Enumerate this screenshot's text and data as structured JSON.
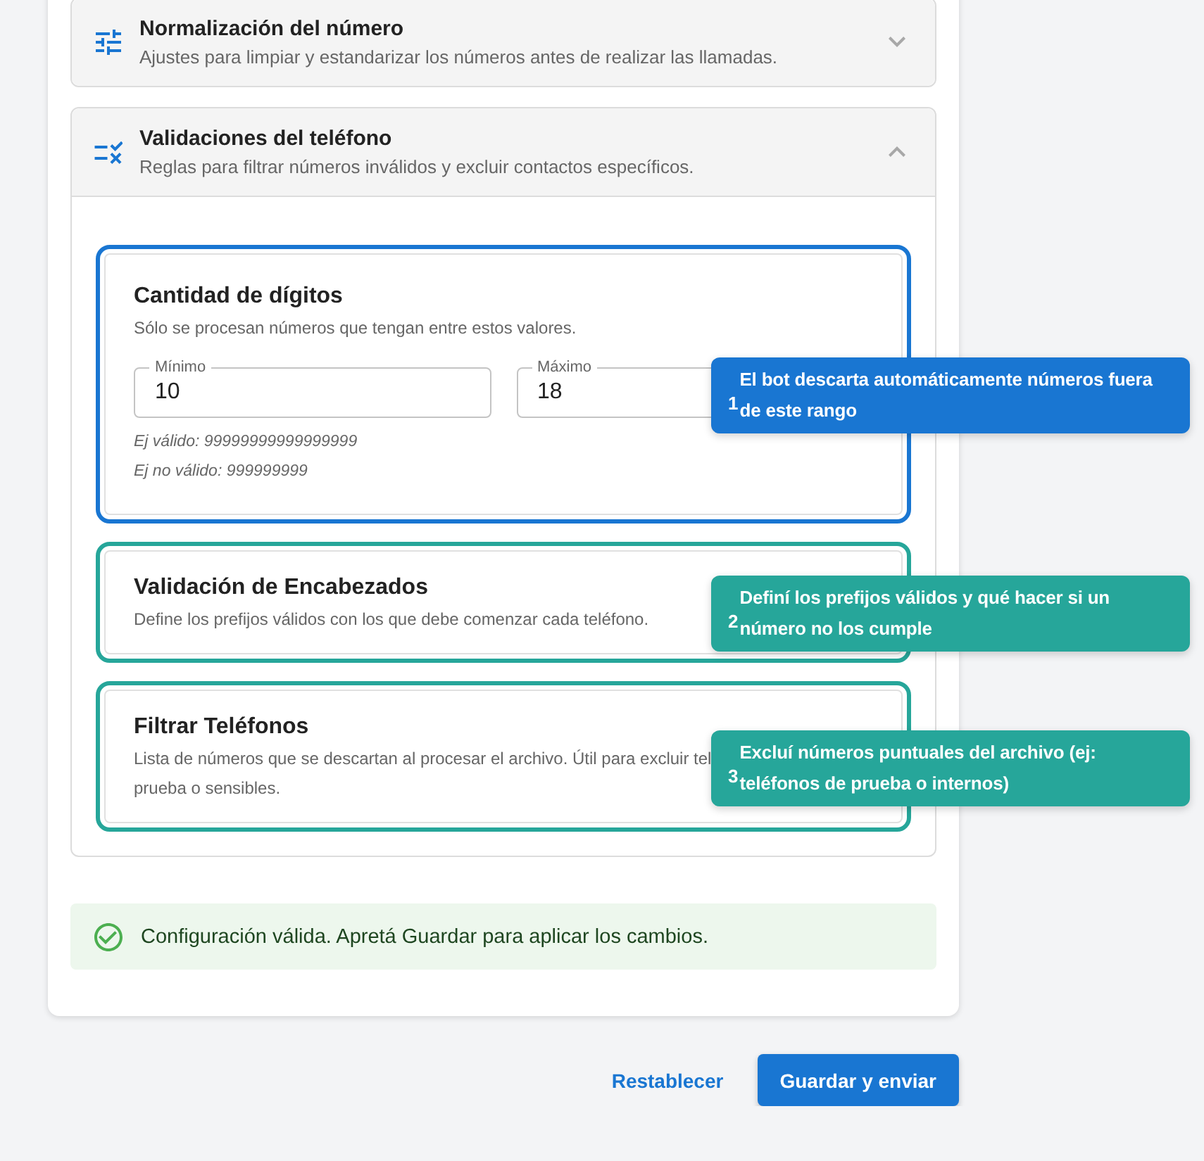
{
  "accordions": [
    {
      "title": "Normalización del número",
      "subtitle": "Ajustes para limpiar y estandarizar los números antes de realizar las llamadas.",
      "expanded": false
    },
    {
      "title": "Validaciones del teléfono",
      "subtitle": "Reglas para filtrar números inválidos y excluir contactos específicos.",
      "expanded": true,
      "sections": [
        {
          "title": "Cantidad de dígitos",
          "description": [
            "Sólo se procesan números que tengan entre estos valores."
          ],
          "fields": [
            {
              "label": "Mínimo",
              "value": "10"
            },
            {
              "label": "Máximo",
              "value": "18"
            }
          ],
          "hints": [
            "Ej válido: 99999999999999999",
            "Ej no válido: 999999999"
          ],
          "callout": {
            "number": "1",
            "text": "El bot descarta automáticamente números fuera de este rango",
            "color": "#1976d2"
          }
        },
        {
          "title": "Validación de Encabezados",
          "description": [
            "Define los prefijos válidos con los que debe comenzar cada teléfono."
          ],
          "callout": {
            "number": "2",
            "text": "Definí los prefijos válidos y qué hacer si un número no los cumple",
            "color": "#26a69a"
          }
        },
        {
          "title": "Filtrar Teléfonos",
          "description": [
            "Lista de números que se descartan al procesar el archivo. Útil para excluir tel",
            "prueba o sensibles."
          ],
          "callout": {
            "number": "3",
            "text": "Excluí números puntuales del archivo (ej: teléfonos de prueba o internos)",
            "color": "#26a69a"
          }
        }
      ]
    }
  ],
  "alert": {
    "text": "Configuración válida. Apretá Guardar para aplicar los cambios."
  },
  "actions": [
    {
      "kind": "text",
      "label": "Restablecer"
    },
    {
      "kind": "primary",
      "label": "Guardar y enviar"
    }
  ]
}
